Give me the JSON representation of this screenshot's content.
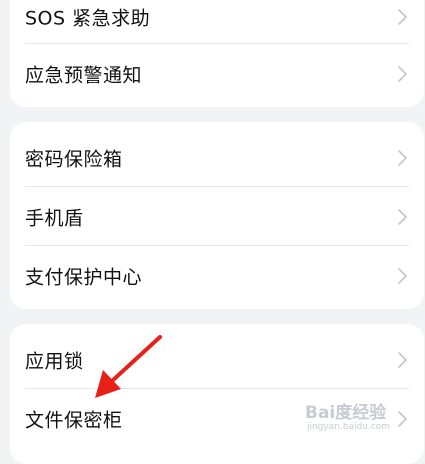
{
  "groups": [
    {
      "items": [
        {
          "label": "SOS 紧急求助",
          "icon": "chevron-right-icon"
        },
        {
          "label": "应急预警通知",
          "icon": "chevron-right-icon"
        }
      ]
    },
    {
      "items": [
        {
          "label": "密码保险箱",
          "icon": "chevron-right-icon"
        },
        {
          "label": "手机盾",
          "icon": "chevron-right-icon"
        },
        {
          "label": "支付保护中心",
          "icon": "chevron-right-icon"
        }
      ]
    },
    {
      "items": [
        {
          "label": "应用锁",
          "icon": "chevron-right-icon"
        },
        {
          "label": "文件保密柜",
          "icon": "chevron-right-icon"
        }
      ]
    }
  ],
  "watermark": {
    "main": "Bai度经验",
    "sub": "jingyan.baidu.com"
  },
  "colors": {
    "background": "#f1f3f5",
    "card": "#ffffff",
    "text": "#111111",
    "chevron": "#c3c6ca",
    "arrow": "#e8201a"
  }
}
